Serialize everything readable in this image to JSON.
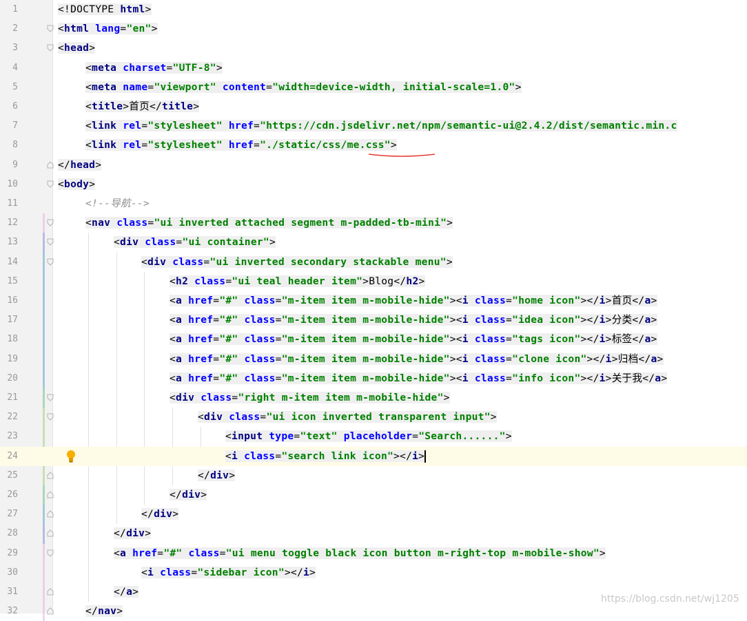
{
  "editor": {
    "line_numbers": [
      "1",
      "2",
      "3",
      "4",
      "5",
      "6",
      "7",
      "8",
      "9",
      "10",
      "11",
      "12",
      "13",
      "14",
      "15",
      "16",
      "17",
      "18",
      "19",
      "20",
      "21",
      "22",
      "23",
      "24",
      "25",
      "26",
      "27",
      "28",
      "29",
      "30",
      "31",
      "32"
    ],
    "lines": [
      [
        [
          "<!DOCTYPE ",
          "txt"
        ],
        [
          "html",
          "tag"
        ],
        [
          ">",
          "txt"
        ]
      ],
      [
        [
          "<",
          "txt"
        ],
        [
          "html ",
          "tag"
        ],
        [
          "lang",
          "attr"
        ],
        [
          "=",
          "txt"
        ],
        [
          "\"en\"",
          "str"
        ],
        [
          ">",
          "txt"
        ]
      ],
      [
        [
          "<",
          "txt"
        ],
        [
          "head",
          "tag"
        ],
        [
          ">",
          "txt"
        ]
      ],
      [
        [
          "<",
          "txt"
        ],
        [
          "meta ",
          "tag"
        ],
        [
          "charset",
          "attr"
        ],
        [
          "=",
          "txt"
        ],
        [
          "\"UTF-8\"",
          "str"
        ],
        [
          ">",
          "txt"
        ]
      ],
      [
        [
          "<",
          "txt"
        ],
        [
          "meta ",
          "tag"
        ],
        [
          "name",
          "attr"
        ],
        [
          "=",
          "txt"
        ],
        [
          "\"viewport\" ",
          "str"
        ],
        [
          "content",
          "attr"
        ],
        [
          "=",
          "txt"
        ],
        [
          "\"width=device-width, initial-scale=1.0\"",
          "str"
        ],
        [
          ">",
          "txt"
        ]
      ],
      [
        [
          "<",
          "txt"
        ],
        [
          "title",
          "tag"
        ],
        [
          ">首页</",
          "txt"
        ],
        [
          "title",
          "tag"
        ],
        [
          ">",
          "txt"
        ]
      ],
      [
        [
          "<",
          "txt"
        ],
        [
          "link ",
          "tag"
        ],
        [
          "rel",
          "attr"
        ],
        [
          "=",
          "txt"
        ],
        [
          "\"stylesheet\" ",
          "str"
        ],
        [
          "href",
          "attr"
        ],
        [
          "=",
          "txt"
        ],
        [
          "\"https://cdn.jsdelivr.net/npm/semantic-ui@2.4.2/dist/semantic.min.c",
          "str"
        ]
      ],
      [
        [
          "<",
          "txt"
        ],
        [
          "link ",
          "tag"
        ],
        [
          "rel",
          "attr"
        ],
        [
          "=",
          "txt"
        ],
        [
          "\"stylesheet\" ",
          "str"
        ],
        [
          "href",
          "attr"
        ],
        [
          "=",
          "txt"
        ],
        [
          "\"./static/css/me.css\"",
          "str"
        ],
        [
          ">",
          "txt"
        ]
      ],
      [
        [
          "</",
          "txt"
        ],
        [
          "head",
          "tag"
        ],
        [
          ">",
          "txt"
        ]
      ],
      [
        [
          "<",
          "txt"
        ],
        [
          "body",
          "tag"
        ],
        [
          ">",
          "txt"
        ]
      ],
      [
        [
          "<!--导航-->",
          "cmt"
        ]
      ],
      [
        [
          "<",
          "txt"
        ],
        [
          "nav ",
          "tag"
        ],
        [
          "class",
          "attr"
        ],
        [
          "=",
          "txt"
        ],
        [
          "\"ui inverted attached segment m-padded-tb-mini\"",
          "str"
        ],
        [
          ">",
          "txt"
        ]
      ],
      [
        [
          "<",
          "txt"
        ],
        [
          "div ",
          "tag"
        ],
        [
          "class",
          "attr"
        ],
        [
          "=",
          "txt"
        ],
        [
          "\"ui container\"",
          "str"
        ],
        [
          ">",
          "txt"
        ]
      ],
      [
        [
          "<",
          "txt"
        ],
        [
          "div ",
          "tag"
        ],
        [
          "class",
          "attr"
        ],
        [
          "=",
          "txt"
        ],
        [
          "\"ui inverted secondary stackable menu\"",
          "str"
        ],
        [
          ">",
          "txt"
        ]
      ],
      [
        [
          "<",
          "txt"
        ],
        [
          "h2 ",
          "tag"
        ],
        [
          "class",
          "attr"
        ],
        [
          "=",
          "txt"
        ],
        [
          "\"ui teal header item\"",
          "str"
        ],
        [
          ">Blog</",
          "txt"
        ],
        [
          "h2",
          "tag"
        ],
        [
          ">",
          "txt"
        ]
      ],
      [
        [
          "<",
          "txt"
        ],
        [
          "a ",
          "tag"
        ],
        [
          "href",
          "attr"
        ],
        [
          "=",
          "txt"
        ],
        [
          "\"#\" ",
          "str"
        ],
        [
          "class",
          "attr"
        ],
        [
          "=",
          "txt"
        ],
        [
          "\"m-item item m-mobile-hide\"",
          "str"
        ],
        [
          "><",
          "txt"
        ],
        [
          "i ",
          "tag"
        ],
        [
          "class",
          "attr"
        ],
        [
          "=",
          "txt"
        ],
        [
          "\"home icon\"",
          "str"
        ],
        [
          "></",
          "txt"
        ],
        [
          "i",
          "tag"
        ],
        [
          ">首页</",
          "txt"
        ],
        [
          "a",
          "tag"
        ],
        [
          ">",
          "txt"
        ]
      ],
      [
        [
          "<",
          "txt"
        ],
        [
          "a ",
          "tag"
        ],
        [
          "href",
          "attr"
        ],
        [
          "=",
          "txt"
        ],
        [
          "\"#\" ",
          "str"
        ],
        [
          "class",
          "attr"
        ],
        [
          "=",
          "txt"
        ],
        [
          "\"m-item item m-mobile-hide\"",
          "str"
        ],
        [
          "><",
          "txt"
        ],
        [
          "i ",
          "tag"
        ],
        [
          "class",
          "attr"
        ],
        [
          "=",
          "txt"
        ],
        [
          "\"idea icon\"",
          "str"
        ],
        [
          "></",
          "txt"
        ],
        [
          "i",
          "tag"
        ],
        [
          ">分类</",
          "txt"
        ],
        [
          "a",
          "tag"
        ],
        [
          ">",
          "txt"
        ]
      ],
      [
        [
          "<",
          "txt"
        ],
        [
          "a ",
          "tag"
        ],
        [
          "href",
          "attr"
        ],
        [
          "=",
          "txt"
        ],
        [
          "\"#\" ",
          "str"
        ],
        [
          "class",
          "attr"
        ],
        [
          "=",
          "txt"
        ],
        [
          "\"m-item item m-mobile-hide\"",
          "str"
        ],
        [
          "><",
          "txt"
        ],
        [
          "i ",
          "tag"
        ],
        [
          "class",
          "attr"
        ],
        [
          "=",
          "txt"
        ],
        [
          "\"tags icon\"",
          "str"
        ],
        [
          "></",
          "txt"
        ],
        [
          "i",
          "tag"
        ],
        [
          ">标签</",
          "txt"
        ],
        [
          "a",
          "tag"
        ],
        [
          ">",
          "txt"
        ]
      ],
      [
        [
          "<",
          "txt"
        ],
        [
          "a ",
          "tag"
        ],
        [
          "href",
          "attr"
        ],
        [
          "=",
          "txt"
        ],
        [
          "\"#\" ",
          "str"
        ],
        [
          "class",
          "attr"
        ],
        [
          "=",
          "txt"
        ],
        [
          "\"m-item item m-mobile-hide\"",
          "str"
        ],
        [
          "><",
          "txt"
        ],
        [
          "i ",
          "tag"
        ],
        [
          "class",
          "attr"
        ],
        [
          "=",
          "txt"
        ],
        [
          "\"clone icon\"",
          "str"
        ],
        [
          "></",
          "txt"
        ],
        [
          "i",
          "tag"
        ],
        [
          ">归档</",
          "txt"
        ],
        [
          "a",
          "tag"
        ],
        [
          ">",
          "txt"
        ]
      ],
      [
        [
          "<",
          "txt"
        ],
        [
          "a ",
          "tag"
        ],
        [
          "href",
          "attr"
        ],
        [
          "=",
          "txt"
        ],
        [
          "\"#\" ",
          "str"
        ],
        [
          "class",
          "attr"
        ],
        [
          "=",
          "txt"
        ],
        [
          "\"m-item item m-mobile-hide\"",
          "str"
        ],
        [
          "><",
          "txt"
        ],
        [
          "i ",
          "tag"
        ],
        [
          "class",
          "attr"
        ],
        [
          "=",
          "txt"
        ],
        [
          "\"info icon\"",
          "str"
        ],
        [
          "></",
          "txt"
        ],
        [
          "i",
          "tag"
        ],
        [
          ">关于我</",
          "txt"
        ],
        [
          "a",
          "tag"
        ],
        [
          ">",
          "txt"
        ]
      ],
      [
        [
          "<",
          "txt"
        ],
        [
          "div ",
          "tag"
        ],
        [
          "class",
          "attr"
        ],
        [
          "=",
          "txt"
        ],
        [
          "\"right m-item item m-mobile-hide\"",
          "str"
        ],
        [
          ">",
          "txt"
        ]
      ],
      [
        [
          "<",
          "txt"
        ],
        [
          "div ",
          "tag"
        ],
        [
          "class",
          "attr"
        ],
        [
          "=",
          "txt"
        ],
        [
          "\"ui icon inverted transparent input\"",
          "str"
        ],
        [
          ">",
          "txt"
        ]
      ],
      [
        [
          "<",
          "txt"
        ],
        [
          "input ",
          "tag"
        ],
        [
          "type",
          "attr"
        ],
        [
          "=",
          "txt"
        ],
        [
          "\"text\" ",
          "str"
        ],
        [
          "placeholder",
          "attr"
        ],
        [
          "=",
          "txt"
        ],
        [
          "\"Search......\"",
          "str"
        ],
        [
          ">",
          "txt"
        ]
      ],
      [
        [
          "<",
          "txt"
        ],
        [
          "i ",
          "tag"
        ],
        [
          "class",
          "attr"
        ],
        [
          "=",
          "txt"
        ],
        [
          "\"search link icon\"",
          "str"
        ],
        [
          "></",
          "txt"
        ],
        [
          "i",
          "tag"
        ],
        [
          ">",
          "txt"
        ]
      ],
      [
        [
          "</",
          "txt"
        ],
        [
          "div",
          "tag"
        ],
        [
          ">",
          "txt"
        ]
      ],
      [
        [
          "</",
          "txt"
        ],
        [
          "div",
          "tag"
        ],
        [
          ">",
          "txt"
        ]
      ],
      [
        [
          "</",
          "txt"
        ],
        [
          "div",
          "tag"
        ],
        [
          ">",
          "txt"
        ]
      ],
      [
        [
          "</",
          "txt"
        ],
        [
          "div",
          "tag"
        ],
        [
          ">",
          "txt"
        ]
      ],
      [
        [
          "<",
          "txt"
        ],
        [
          "a ",
          "tag"
        ],
        [
          "href",
          "attr"
        ],
        [
          "=",
          "txt"
        ],
        [
          "\"#\" ",
          "str"
        ],
        [
          "class",
          "attr"
        ],
        [
          "=",
          "txt"
        ],
        [
          "\"ui menu toggle black icon button m-right-top m-mobile-show\"",
          "str"
        ],
        [
          ">",
          "txt"
        ]
      ],
      [
        [
          "<",
          "txt"
        ],
        [
          "i ",
          "tag"
        ],
        [
          "class",
          "attr"
        ],
        [
          "=",
          "txt"
        ],
        [
          "\"sidebar icon\"",
          "str"
        ],
        [
          "></",
          "txt"
        ],
        [
          "i",
          "tag"
        ],
        [
          ">",
          "txt"
        ]
      ],
      [
        [
          "</",
          "txt"
        ],
        [
          "a",
          "tag"
        ],
        [
          ">",
          "txt"
        ]
      ],
      [
        [
          "</",
          "txt"
        ],
        [
          "nav",
          "tag"
        ],
        [
          ">",
          "txt"
        ]
      ]
    ]
  },
  "colors": {
    "tag": "#000080",
    "attribute": "#0000ff",
    "string": "#008000",
    "comment": "#8c8c8c",
    "current_line": "#fefbe6"
  },
  "icons": {
    "gutter_bulb": "lightbulb-icon",
    "fold": "fold-marker-icon"
  },
  "watermark": "https://blog.csdn.net/wj1205"
}
